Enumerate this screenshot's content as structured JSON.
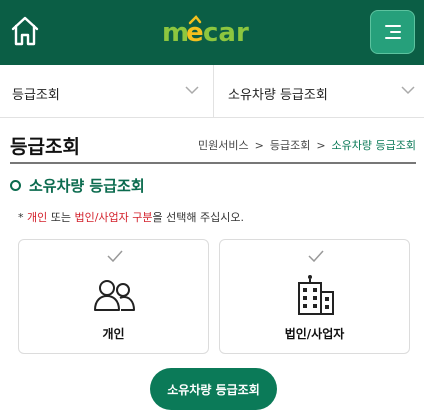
{
  "header": {
    "logo_text": "mecar",
    "colors": {
      "bar": "#0b5e45",
      "menu_button": "#26a07b",
      "logo_green": "#8dc63f",
      "logo_yellow": "#f3c01e"
    }
  },
  "nav": {
    "select1_label": "등급조회",
    "select2_label": "소유차량 등급조회"
  },
  "page": {
    "title": "등급조회",
    "breadcrumb": [
      "민원서비스",
      "등급조회",
      "소유차량 등급조회"
    ],
    "breadcrumb_sep": ">"
  },
  "section": {
    "title": "소유차량 등급조회"
  },
  "notice": {
    "prefix": "* ",
    "personal": "개인",
    "or": " 또는 ",
    "corporate": "법인/사업자 구분",
    "suffix": "을 선택해 주십시오."
  },
  "options": [
    {
      "label": "개인",
      "icon": "people-icon"
    },
    {
      "label": "법인/사업자",
      "icon": "building-icon"
    }
  ],
  "submit_label": "소유차량 등급조회",
  "accent_color": "#0b7a58",
  "highlight_color": "#d3212c"
}
